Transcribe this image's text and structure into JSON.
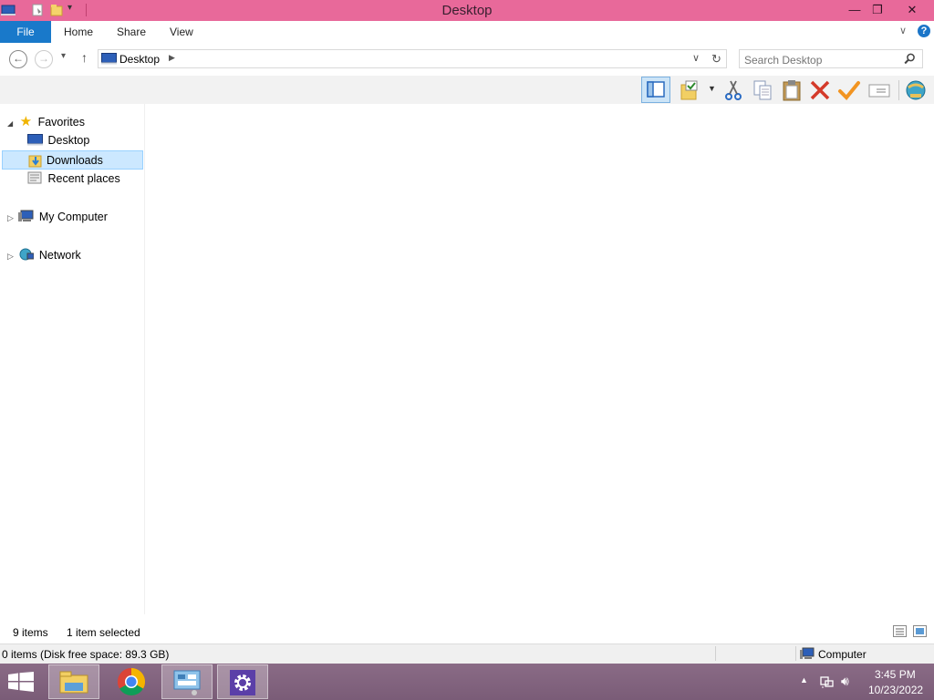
{
  "window": {
    "title": "Desktop",
    "minimize_glyph": "—",
    "restore_glyph": "❐",
    "close_glyph": "✕"
  },
  "ribbon": {
    "tabs": [
      {
        "label": "File"
      },
      {
        "label": "Home"
      },
      {
        "label": "Share"
      },
      {
        "label": "View"
      }
    ]
  },
  "address": {
    "location": "Desktop",
    "search_placeholder": "Search Desktop"
  },
  "toolbar": {
    "icons": [
      "preview-pane-icon",
      "select-folder-icon",
      "cut-icon",
      "copy-icon",
      "paste-icon",
      "delete-icon",
      "apply-icon",
      "properties-icon",
      "network-icon"
    ]
  },
  "nav": {
    "favorites": "Favorites",
    "desktop": "Desktop",
    "downloads": "Downloads",
    "recent": "Recent places",
    "computer": "My Computer",
    "network": "Network"
  },
  "status": {
    "items": "9 items",
    "selected": "1 item selected",
    "disk": "0 items (Disk free space: 89.3 GB)",
    "location": "Computer"
  },
  "taskbar": {
    "time": "3:45 PM",
    "date": "10/23/2022"
  },
  "colors": {
    "titlebar": "#e8699a",
    "file_tab": "#1979ca",
    "selection": "#cce8ff",
    "taskbar": "#7a5c77"
  }
}
